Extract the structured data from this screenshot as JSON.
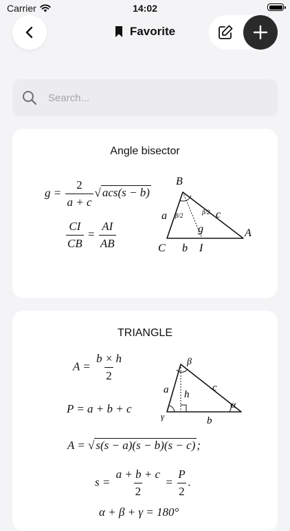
{
  "status": {
    "carrier": "Carrier",
    "time": "14:02"
  },
  "header": {
    "title": "Favorite"
  },
  "search": {
    "placeholder": "Search..."
  },
  "cards": [
    {
      "title": "Angle bisector",
      "formula_1": {
        "lhs": "g =",
        "num": "2",
        "den": "a + c",
        "radicand": "acs(s − b)"
      },
      "formula_2": {
        "num_l": "CI",
        "den_l": "CB",
        "eq": "=",
        "num_r": "AI",
        "den_r": "AB"
      },
      "figure": {
        "vertex_a": "A",
        "vertex_b": "B",
        "vertex_c": "C",
        "point_i": "I",
        "side_a": "a",
        "side_b": "b",
        "side_c": "c",
        "bisector": "g",
        "angle_l": "β/2",
        "angle_r": "β/2"
      }
    },
    {
      "title": "TRIANGLE",
      "formula_1": {
        "lhs": "A =",
        "num": "b × h",
        "den": "2"
      },
      "formula_2": "P = a + b + c",
      "formula_3": {
        "lhs": "A =",
        "radicand": "s(s − a)(s − b)(s − c)",
        "tail": ";"
      },
      "formula_4": {
        "lhs": "s =",
        "num": "a + b + c",
        "den": "2",
        "eq": "=",
        "num_2": "P",
        "den_2": "2",
        "tail": "."
      },
      "formula_5": "α + β + γ = 180°",
      "figure": {
        "angle_beta": "β",
        "angle_alpha": "α",
        "angle_gamma": "γ",
        "side_a": "a",
        "side_b": "b",
        "side_c": "c",
        "height": "h"
      }
    }
  ]
}
